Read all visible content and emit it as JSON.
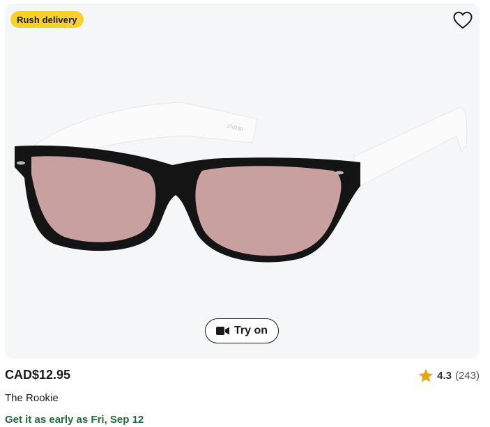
{
  "product": {
    "badge": "Rush delivery",
    "frame_code": "270230",
    "try_on_label": "Try on",
    "price": "CAD$12.95",
    "name": "The Rookie",
    "delivery": "Get it as early as Fri, Sep 12",
    "rating": {
      "score": "4.3",
      "count": "(243)"
    }
  },
  "icons": {
    "favorite": "heart-outline-icon",
    "try_on": "video-camera-icon",
    "rating": "star-icon"
  },
  "colors": {
    "badge_bg": "#f7d12b",
    "delivery_text": "#1f6b3a",
    "star": "#e8a317",
    "lens": "#c9a0a0",
    "frame": "#141414",
    "temple": "#fbfbfb"
  }
}
